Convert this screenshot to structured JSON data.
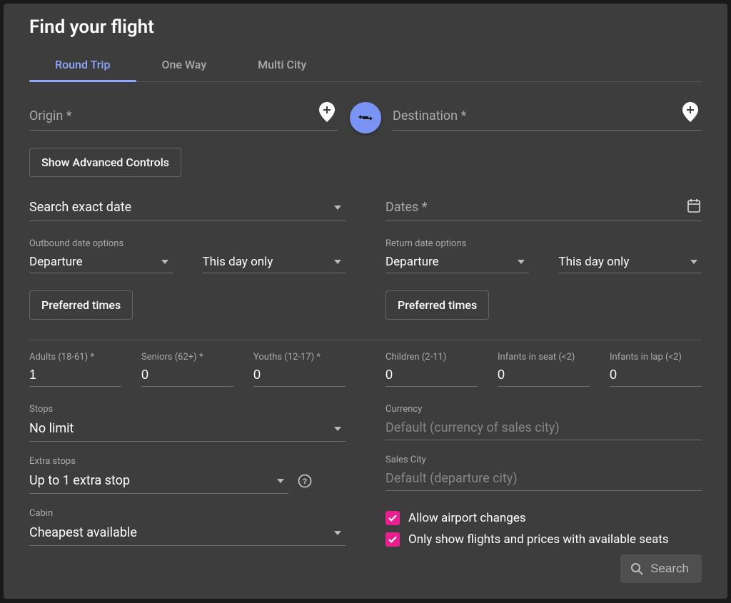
{
  "title": "Find your flight",
  "tabs": [
    {
      "label": "Round Trip",
      "active": true
    },
    {
      "label": "One Way",
      "active": false
    },
    {
      "label": "Multi City",
      "active": false
    }
  ],
  "origin": {
    "label": "Origin *"
  },
  "destination": {
    "label": "Destination *"
  },
  "advanced_controls_btn": "Show Advanced Controls",
  "search_exact": {
    "value": "Search exact date"
  },
  "dates": {
    "label": "Dates *"
  },
  "outbound": {
    "group_label": "Outbound date options",
    "mode": "Departure",
    "range": "This day only",
    "preferred_btn": "Preferred times"
  },
  "return": {
    "group_label": "Return date options",
    "mode": "Departure",
    "range": "This day only",
    "preferred_btn": "Preferred times"
  },
  "pax": {
    "adults": {
      "label": "Adults (18-61) *",
      "value": "1"
    },
    "seniors": {
      "label": "Seniors (62+) *",
      "value": "0"
    },
    "youths": {
      "label": "Youths (12-17) *",
      "value": "0"
    },
    "children": {
      "label": "Children (2-11)",
      "value": "0"
    },
    "inf_seat": {
      "label": "Infants in seat (<2)",
      "value": "0"
    },
    "inf_lap": {
      "label": "Infants in lap (<2)",
      "value": "0"
    }
  },
  "stops": {
    "label": "Stops",
    "value": "No limit"
  },
  "extra_stops": {
    "label": "Extra stops",
    "value": "Up to 1 extra stop"
  },
  "cabin": {
    "label": "Cabin",
    "value": "Cheapest available"
  },
  "currency": {
    "label": "Currency",
    "placeholder": "Default (currency of sales city)"
  },
  "sales_city": {
    "label": "Sales City",
    "placeholder": "Default (departure city)"
  },
  "checks": {
    "airport_changes": "Allow airport changes",
    "only_available": "Only show flights and prices with available seats"
  },
  "search_btn": "Search"
}
